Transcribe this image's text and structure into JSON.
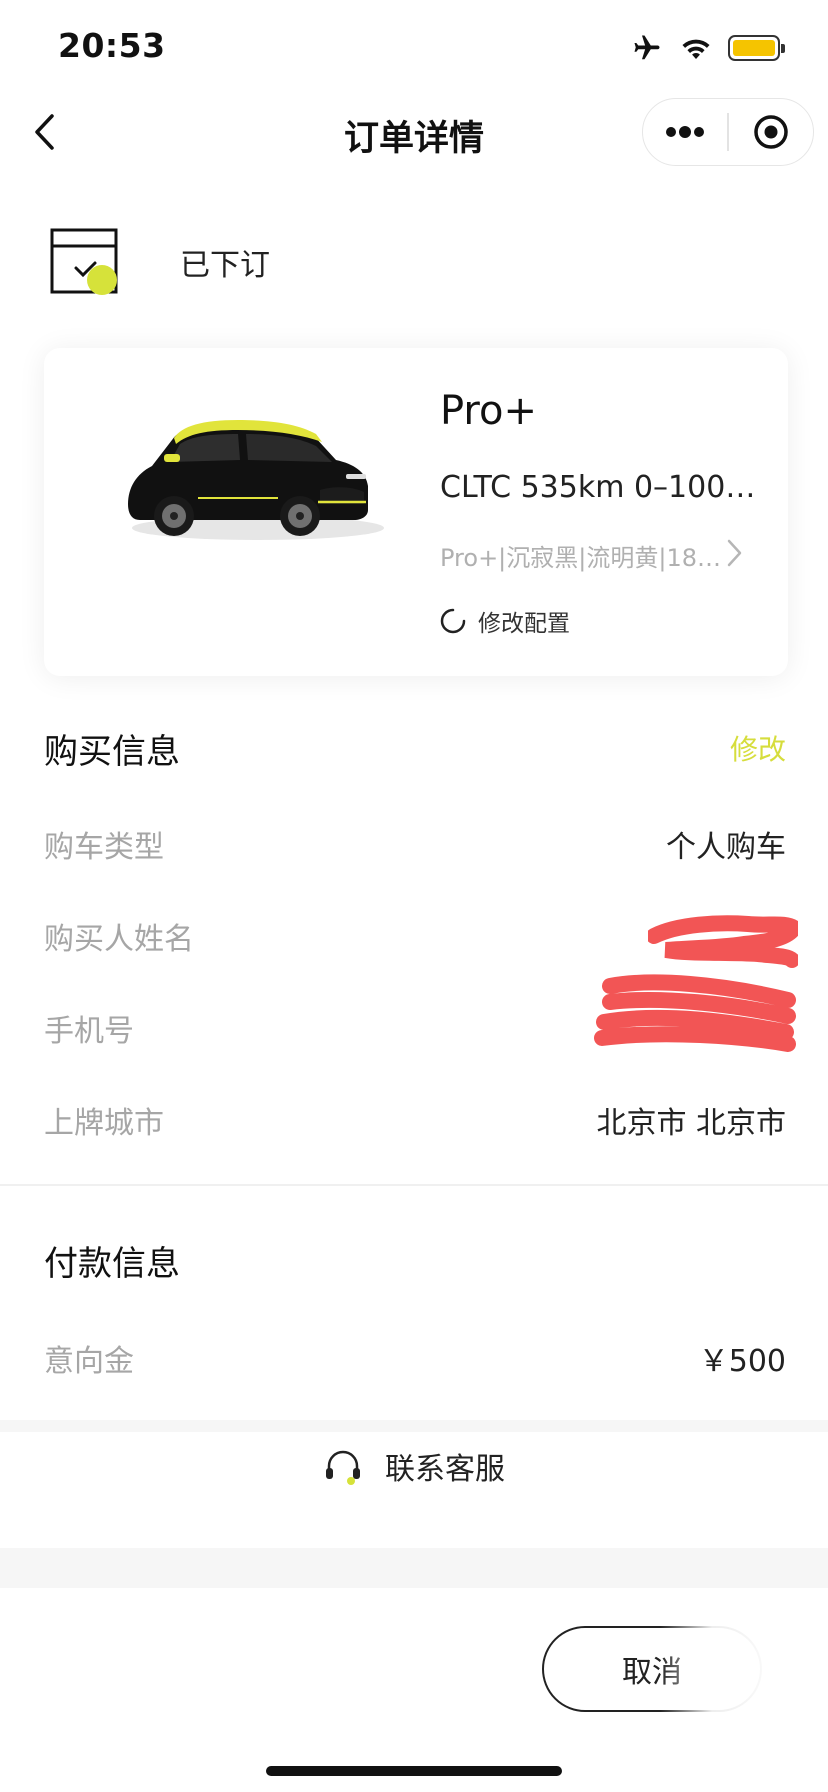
{
  "status_bar": {
    "time": "20:53",
    "icons": [
      "airplane-icon",
      "wifi-icon",
      "battery-icon"
    ],
    "battery_color": "#f5c400"
  },
  "nav": {
    "title": "订单详情",
    "back_icon": "chevron-left-icon",
    "capsule_icons": [
      "more-dots-icon",
      "close-target-icon"
    ]
  },
  "order": {
    "status": "已下订",
    "status_icon": "calendar-check-icon",
    "accent_color": "#d6e23a"
  },
  "vehicle": {
    "trim": "Pro+",
    "spec": "CLTC 535km 0–100km...",
    "config": "Pro+|沉寂黑|流明黄|18英...",
    "modify_label": "修改配置"
  },
  "purchase_info": {
    "title": "购买信息",
    "edit_label": "修改",
    "rows": [
      {
        "label": "购车类型",
        "value": "个人购车"
      },
      {
        "label": "购买人姓名",
        "value": ""
      },
      {
        "label": "手机号",
        "value": ""
      },
      {
        "label": "上牌城市",
        "value": "北京市 北京市"
      }
    ]
  },
  "payment_info": {
    "title": "付款信息",
    "rows": [
      {
        "label": "意向金",
        "value": "￥500"
      }
    ]
  },
  "support": {
    "label": "联系客服",
    "icon": "headset-icon"
  },
  "actions": {
    "cancel_label": "取消"
  }
}
